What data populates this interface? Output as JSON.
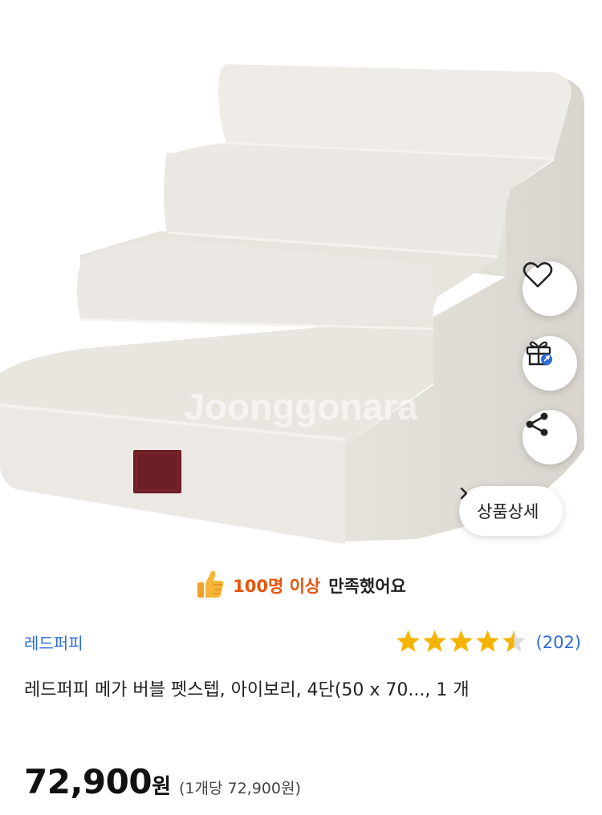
{
  "product_image": {
    "watermark": "Joonggonara"
  },
  "actions": {
    "detail_label": "상품상세"
  },
  "satisfaction": {
    "highlight": "100명 이상",
    "rest": "만족했어요"
  },
  "seller": {
    "name": "레드퍼피"
  },
  "rating": {
    "stars": 4.5,
    "count": "(202)"
  },
  "product": {
    "title": "레드퍼피 메가 버블 펫스텝, 아이보리, 4단(50 x 70..., 1 개"
  },
  "price": {
    "amount": "72,900",
    "currency": "원",
    "unit_price": "(1개당 72,900원)"
  },
  "colors": {
    "accent_orange": "#e8540c",
    "link_blue": "#2d6bd8",
    "star_gold": "#f5b400"
  }
}
